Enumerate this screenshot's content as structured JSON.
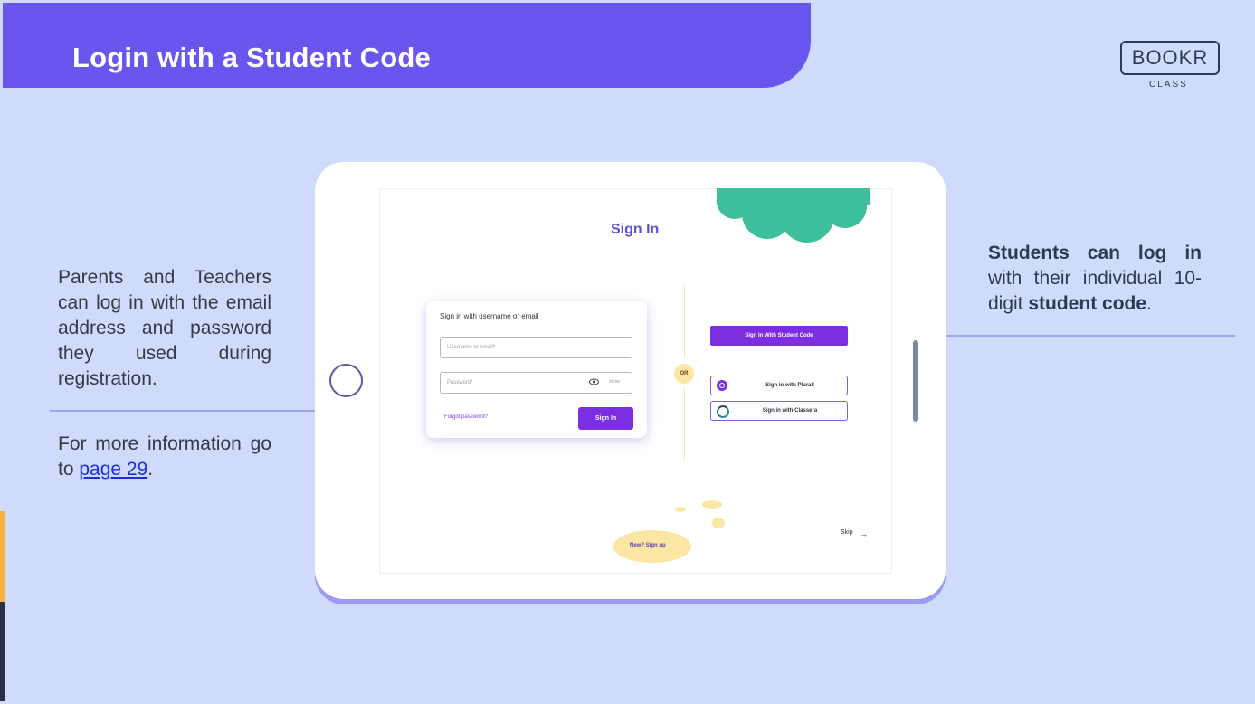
{
  "slide": {
    "title": "Login with a Student Code",
    "logo": {
      "brand": "BOOKR",
      "sub": "CLASS"
    },
    "left_text": "Parents and Teachers can log in with the email address and password they used during registration.",
    "more_info": {
      "prefix": "For more information go to ",
      "link": "page 29",
      "suffix": "."
    },
    "right_text": {
      "bold": "Students can log in",
      "middle": " with their individual 10-digit ",
      "bold2": "student code",
      "suffix": "."
    }
  },
  "screen": {
    "title": "Sign In",
    "form_heading": "Sign in with username or email",
    "username_placeholder": "Username or email*",
    "password_placeholder": "Password*",
    "show_label": "show",
    "forgot_label": "Forgot password?",
    "signin_label": "Sign In",
    "or_label": "OR",
    "student_code_label": "Sign In With Student Code",
    "plural_label": "Sign in with Plurall",
    "classera_label": "Sign in with Classera",
    "signup_label": "New? Sign up",
    "skip_label": "Skip"
  },
  "colors": {
    "banner": "#6a55ef",
    "background": "#d0dbfb",
    "accent_purple": "#7b2fe0",
    "cloud": "#3dbf9c",
    "yellow": "#fbe6a3"
  }
}
